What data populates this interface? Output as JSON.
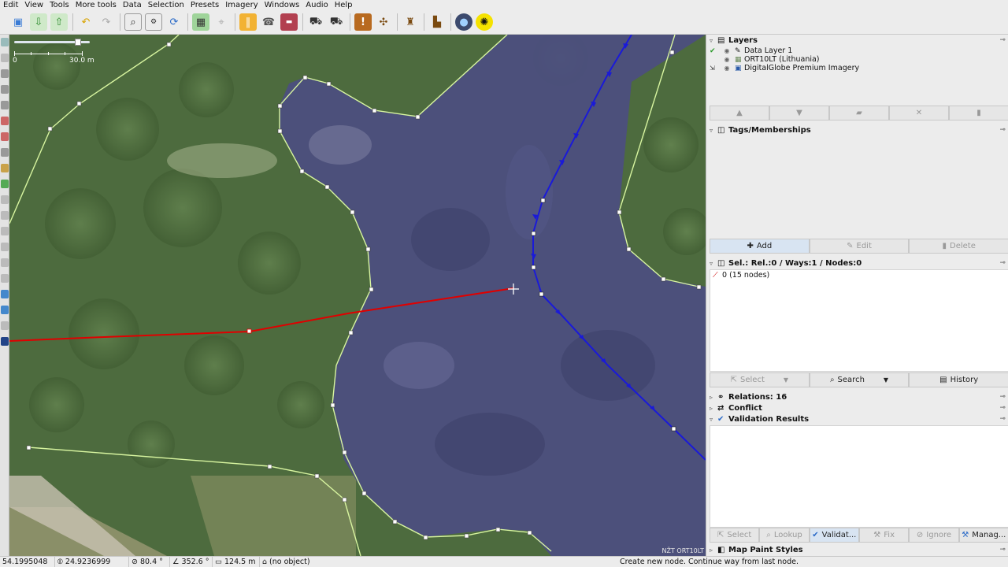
{
  "menu": [
    "Edit",
    "View",
    "Tools",
    "More tools",
    "Data",
    "Selection",
    "Presets",
    "Imagery",
    "Windows",
    "Audio",
    "Help"
  ],
  "toolbar_icons": [
    "open-icon",
    "download-icon",
    "upload-icon",
    "undo-icon",
    "redo-icon",
    "zoom-icon",
    "preferences-icon",
    "refresh-icon",
    "image-icon",
    "zoom-layer-icon",
    "highway-icon",
    "phone-icon",
    "parking-icon",
    "car-icon",
    "car-2-icon",
    "info-icon",
    "restaurant-icon",
    "craft-icon",
    "chart-icon",
    "mapillary-icon",
    "sun-icon"
  ],
  "map": {
    "scale_start": "0",
    "scale_end": "30.0 m",
    "attribution": "NŽT ORT10LT",
    "colors": {
      "selected_way": "#e00000",
      "blue_way": "#1a1ad8",
      "area_outline": "#d8f5a0",
      "water_fill": "#4c4e80"
    }
  },
  "panels": {
    "layers": {
      "title": "Layers",
      "items": [
        {
          "name": "Data Layer 1",
          "active": true,
          "icon": "pencil-icon"
        },
        {
          "name": "ORT10LT (Lithuania)",
          "active": false,
          "icon": "imagery-icon"
        },
        {
          "name": "DigitalGlobe Premium Imagery",
          "active": false,
          "icon": "globe-icon"
        }
      ]
    },
    "tags": {
      "title": "Tags/Memberships",
      "buttons": {
        "add": "Add",
        "edit": "Edit",
        "delete": "Delete"
      }
    },
    "selection": {
      "title": "Sel.: Rel.:0 / Ways:1 / Nodes:0",
      "items": [
        "0 (15 nodes)"
      ],
      "buttons": {
        "select": "Select",
        "search": "Search",
        "history": "History"
      }
    },
    "relations": {
      "title": "Relations: 16"
    },
    "conflict": {
      "title": "Conflict"
    },
    "validation": {
      "title": "Validation Results",
      "buttons": {
        "select": "Select",
        "lookup": "Lookup",
        "validate": "Validat...",
        "fix": "Fix",
        "ignore": "Ignore",
        "manage": "Manag..."
      }
    },
    "mappaint": {
      "title": "Map Paint Styles"
    }
  },
  "status": {
    "lat": "54.1995048",
    "lon": "24.9236999",
    "heading": "80.4 °",
    "angle": "352.6 °",
    "length": "124.5 m",
    "object": "(no object)",
    "hint": "Create new node. Continue way from last node."
  }
}
